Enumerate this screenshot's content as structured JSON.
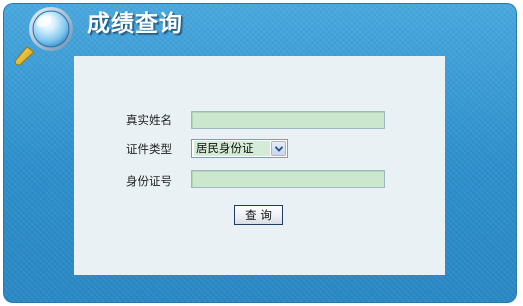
{
  "header": {
    "title": "成绩查询",
    "icon": "magnifier-icon"
  },
  "form": {
    "name_label": "真实姓名",
    "name_value": "",
    "id_type_label": "证件类型",
    "id_type_selected": "居民身份证",
    "id_number_label": "身份证号",
    "id_number_value": "",
    "submit_label": "查 询"
  },
  "colors": {
    "panel_blue": "#2f93ce",
    "content_bg": "#e9f1f5",
    "input_bg": "#cbe7cd",
    "title_text": "#ffffff"
  }
}
